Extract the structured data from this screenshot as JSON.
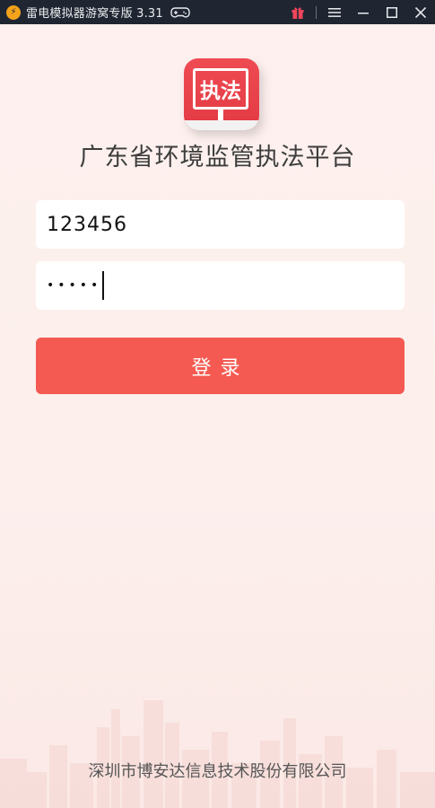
{
  "window": {
    "title": "雷电模拟器游窝专版 3.31",
    "logo_icon": "leidian-logo-icon",
    "accent": "#f4a31a",
    "background": "#1f2631",
    "controls": [
      "gift-icon",
      "menu-icon",
      "minimize-icon",
      "maximize-icon",
      "close-icon"
    ]
  },
  "app": {
    "icon_text": "执法",
    "title": "广东省环境监管执法平台",
    "username": {
      "value": "123456"
    },
    "password": {
      "masked_value": "•••••"
    },
    "login_label": "登录",
    "footer": "深圳市博安达信息技术股份有限公司",
    "accent": "#f45a52",
    "icon_red": "#e23a44"
  }
}
